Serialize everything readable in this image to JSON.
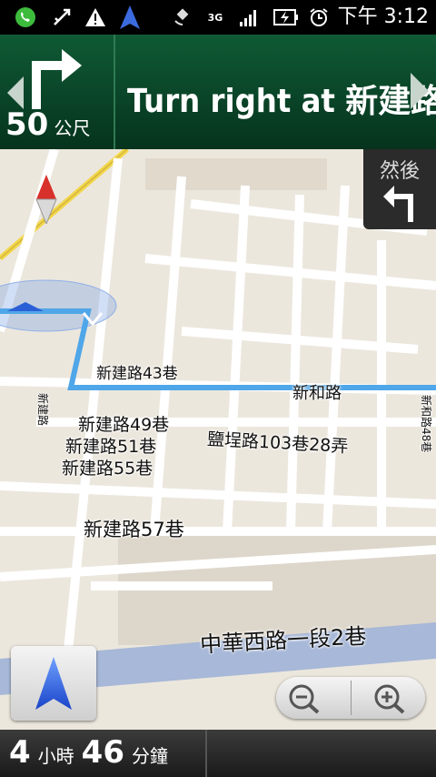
{
  "status_bar": {
    "icons": [
      "whatsapp-icon",
      "usb-debug-icon",
      "warning-icon",
      "navigation-icon",
      "gps-icon",
      "3g-icon",
      "signal-icon",
      "battery-charging-icon",
      "alarm-icon"
    ],
    "network": "3G",
    "time": "下午 3:12"
  },
  "nav": {
    "distance_value": "50",
    "distance_unit": "公尺",
    "instruction": "Turn right at 新建路",
    "then_label": "然後"
  },
  "map": {
    "labels": {
      "l1": "新建路43巷",
      "l2": "新和路",
      "l3": "新建路49巷",
      "l4": "新建路51巷",
      "l5": "新建路55巷",
      "l6": "鹽埕路103巷28弄",
      "l7": "新建路57巷",
      "l8": "中華西路一段2巷",
      "l9": "新建路",
      "l10": "新和路48巷"
    }
  },
  "bottom": {
    "hours": "4",
    "hours_unit": "小時",
    "minutes": "46",
    "minutes_unit": "分鐘"
  },
  "colors": {
    "header_green": "#0f5a35",
    "route_blue": "#4fa6e8",
    "map_bg": "#ece7dd"
  }
}
